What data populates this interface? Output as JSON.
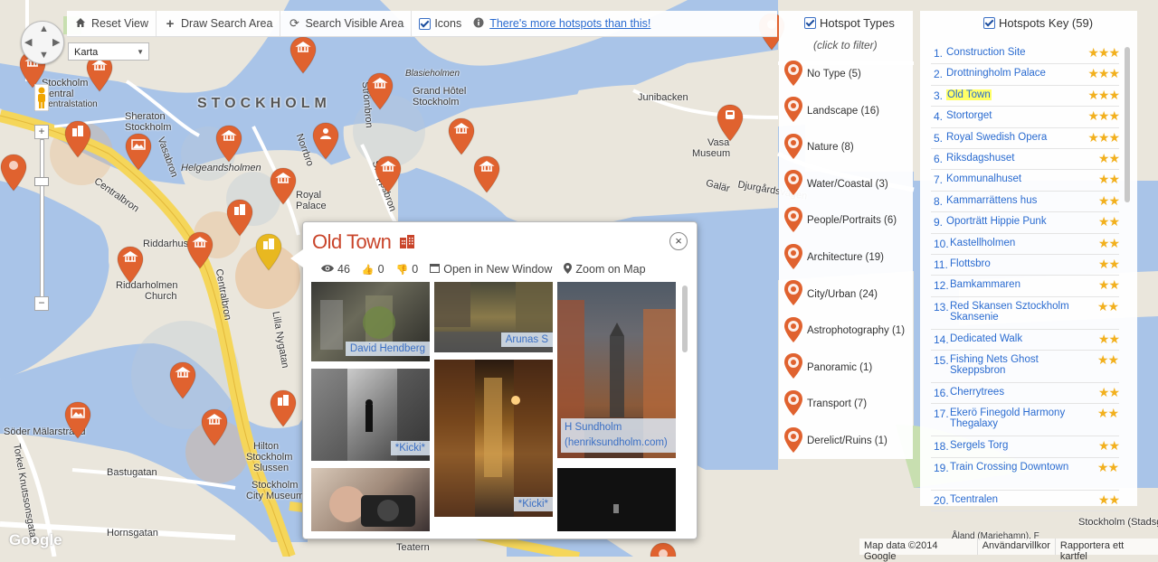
{
  "toolbar": {
    "reset_label": "Reset View",
    "draw_label": "Draw Search Area",
    "search_label": "Search Visible Area",
    "icons_label": "Icons",
    "more_link": "There's more hotspots than this!"
  },
  "map_controls": {
    "map_type": "Karta"
  },
  "map_labels": {
    "stockholm": "STOCKHOLM",
    "stockholm_central_l1": "Stockholm",
    "stockholm_central_l2": "Central",
    "stockholm_central_l3": "Centralstation",
    "sheraton_l1": "Sheraton",
    "sheraton_l2": "Stockholm",
    "blasieholmen": "Blasieholmen",
    "grand_hotel_l1": "Grand Hôtel",
    "grand_hotel_l2": "Stockholm",
    "helgeandsholmen": "Helgeandsholmen",
    "norrbro": "Norrbro",
    "royal_palace_l1": "Royal",
    "royal_palace_l2": "Palace",
    "strombron": "Strömbron",
    "skeppsbron": "Skeppsbron",
    "riddarhus": "Riddarhus",
    "riddarholmen_church_l1": "Riddarholmen",
    "riddarholmen_church_l2": "Church",
    "centralbron": "Centralbron",
    "vasabron": "Vasabron",
    "lilla_nygatan": "Lilla Nygatan",
    "junibacken": "Junibacken",
    "vasa_museum_l1": "Vasa",
    "vasa_museum_l2": "Museum",
    "soder_malarstrand": "Söder Mälarstrand",
    "hilton_l1": "Hilton",
    "hilton_l2": "Stockholm",
    "hilton_l3": "Slussen",
    "bastugatan": "Bastugatan",
    "city_museum_l1": "Stockholm",
    "city_museum_l2": "City Museum",
    "hornsgatan": "Hornsgatan",
    "torkel": "Torkel Knutssonsgatan",
    "teatern": "Teatern",
    "stockholm_stadsgard": "Stockholm (Stadsg",
    "djurgardsvagen": "Djurgårdsvägen",
    "galar": "Galär",
    "kastellholmen": "Kastellh",
    "aland": "Åland (Mariehamn), F"
  },
  "popup": {
    "title": "Old Town",
    "views": "46",
    "likes": "0",
    "dislikes": "0",
    "open_label": "Open in New Window",
    "zoom_label": "Zoom on Map",
    "photos": [
      {
        "credit": "David Hendberg"
      },
      {
        "credit": "Arunas S"
      },
      {
        "credit": "H Sundholm (henriksundholm.com)"
      },
      {
        "credit": "*Kicki*"
      },
      {
        "credit": "*Kicki*"
      },
      {
        "credit": ""
      },
      {
        "credit": ""
      }
    ]
  },
  "hotspot_types": {
    "header": "Hotspot Types",
    "subtitle": "(click to filter)",
    "items": [
      {
        "label": "No Type (5)",
        "icon": "no-type-icon"
      },
      {
        "label": "Landscape (16)",
        "icon": "landscape-icon"
      },
      {
        "label": "Nature (8)",
        "icon": "nature-icon"
      },
      {
        "label": "Water/Coastal (3)",
        "icon": "water-icon"
      },
      {
        "label": "People/Portraits (6)",
        "icon": "person-icon"
      },
      {
        "label": "Architecture (19)",
        "icon": "architecture-icon"
      },
      {
        "label": "City/Urban (24)",
        "icon": "city-icon"
      },
      {
        "label": "Astrophotography (1)",
        "icon": "moon-icon"
      },
      {
        "label": "Panoramic (1)",
        "icon": "panorama-icon"
      },
      {
        "label": "Transport (7)",
        "icon": "train-icon"
      },
      {
        "label": "Derelict/Ruins (1)",
        "icon": "ruins-icon"
      }
    ]
  },
  "hotspots_key": {
    "header": "Hotspots Key (59)",
    "items": [
      {
        "num": "1.",
        "name": "Construction Site",
        "stars": "★★★",
        "highlight": false
      },
      {
        "num": "2.",
        "name": "Drottningholm Palace",
        "stars": "★★★",
        "highlight": false
      },
      {
        "num": "3.",
        "name": "Old Town",
        "stars": "★★★",
        "highlight": true
      },
      {
        "num": "4.",
        "name": "Stortorget",
        "stars": "★★★",
        "highlight": false
      },
      {
        "num": "5.",
        "name": "Royal Swedish Opera",
        "stars": "★★★",
        "highlight": false
      },
      {
        "num": "6.",
        "name": "Riksdagshuset",
        "stars": "★★",
        "highlight": false
      },
      {
        "num": "7.",
        "name": "Kommunalhuset",
        "stars": "★★",
        "highlight": false
      },
      {
        "num": "8.",
        "name": "Kammarrättens hus",
        "stars": "★★",
        "highlight": false
      },
      {
        "num": "9.",
        "name": "Oporträtt Hippie Punk",
        "stars": "★★",
        "highlight": false
      },
      {
        "num": "10.",
        "name": "Kastellholmen",
        "stars": "★★",
        "highlight": false
      },
      {
        "num": "11.",
        "name": "Flottsbro",
        "stars": "★★",
        "highlight": false
      },
      {
        "num": "12.",
        "name": "Bamkammaren",
        "stars": "★★",
        "highlight": false
      },
      {
        "num": "13.",
        "name": "Red Skansen Sztockholm Skansenie",
        "stars": "★★",
        "highlight": false
      },
      {
        "num": "14.",
        "name": "Dedicated Walk",
        "stars": "★★",
        "highlight": false
      },
      {
        "num": "15.",
        "name": "Fishing Nets Ghost Skeppsbron",
        "stars": "★★",
        "highlight": false
      },
      {
        "num": "16.",
        "name": "Cherrytrees",
        "stars": "★★",
        "highlight": false
      },
      {
        "num": "17.",
        "name": "Ekerö Finegold Harmony Thegalaxy",
        "stars": "★★",
        "highlight": false
      },
      {
        "num": "18.",
        "name": "Sergels Torg",
        "stars": "★★",
        "highlight": false
      },
      {
        "num": "19.",
        "name": "Train Crossing Downtown",
        "stars": "★★",
        "highlight": false
      },
      {
        "num": "20.",
        "name": "Tcentralen",
        "stars": "★★",
        "highlight": false
      }
    ]
  },
  "attribution": {
    "mapdata": "Map data ©2014 Google",
    "terms": "Användarvillkor",
    "report": "Rapportera ett kartfel",
    "logo": "Google"
  },
  "colors": {
    "water": "#a9c4e8",
    "land": "#eae6dc",
    "road_yellow": "#f5d65a",
    "pin_orange": "#e0622f",
    "pin_yellow": "#e8b820",
    "title_red": "#c9452b",
    "link_blue": "#2a6bd0",
    "star_gold": "#f2b01e"
  }
}
